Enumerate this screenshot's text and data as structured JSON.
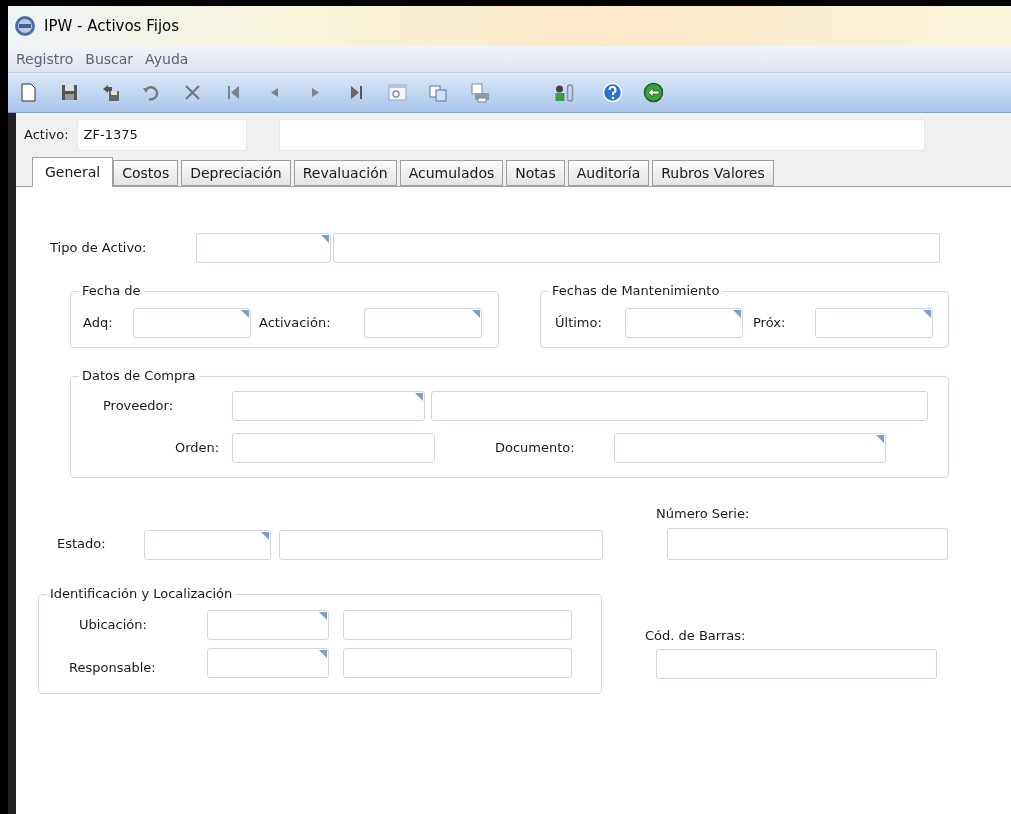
{
  "window": {
    "title": "IPW - Activos Fijos"
  },
  "menu": [
    "Registro",
    "Buscar",
    "Ayuda"
  ],
  "activo": {
    "label": "Activo:",
    "value": "ZF-1375"
  },
  "tabs": [
    {
      "label": "General",
      "selected": true
    },
    {
      "label": "Costos",
      "selected": false
    },
    {
      "label": "Depreciación",
      "selected": false
    },
    {
      "label": "Revaluación",
      "selected": false
    },
    {
      "label": "Acumulados",
      "selected": false
    },
    {
      "label": "Notas",
      "selected": false
    },
    {
      "label": "Auditoría",
      "selected": false
    },
    {
      "label": "Rubros Valores",
      "selected": false
    }
  ],
  "tipo_de_activo": {
    "label": "Tipo de Activo:"
  },
  "fecha_de": {
    "title": "Fecha de",
    "adq": "Adq:",
    "activacion": "Activación:"
  },
  "fechas_de_mantenimiento": {
    "title": "Fechas de Mantenimiento",
    "ultimo": "Último:",
    "prox": "Próx:"
  },
  "datos_de_compra": {
    "title": "Datos de Compra",
    "proveedor": "Proveedor:",
    "orden": "Orden:",
    "documento": "Documento:"
  },
  "estado": {
    "label": "Estado:"
  },
  "numero_serie": {
    "label": "Número Serie:"
  },
  "identificacion_y_localizacion": {
    "title": "Identificación y Localización",
    "ubicacion": "Ubicación:",
    "responsable": "Responsable:"
  },
  "cod_de_barras": {
    "label": "Cód. de Barras:"
  }
}
